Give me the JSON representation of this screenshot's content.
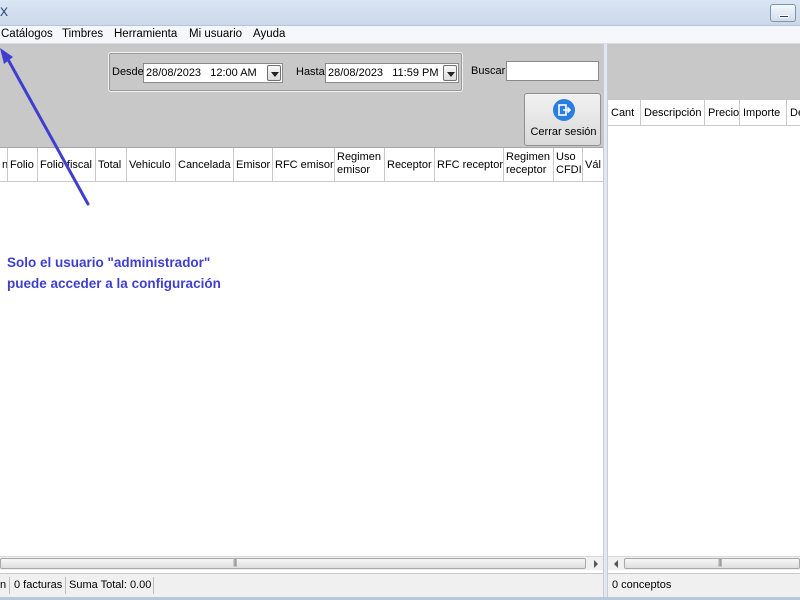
{
  "window": {
    "title_fragment": "X"
  },
  "menu": {
    "items": [
      "Catálogos",
      "Timbres",
      "Herramienta",
      "Mi usuario",
      "Ayuda"
    ]
  },
  "filters": {
    "desde_label": "Desde",
    "desde_date": "28/08/2023",
    "desde_time": "12:00  AM",
    "hasta_label": "Hasta",
    "hasta_date": "28/08/2023",
    "hasta_time": "11:59  PM",
    "buscar_label": "Buscar",
    "buscar_value": ""
  },
  "logout": {
    "label": "Cerrar sesión",
    "icon": "logout-icon",
    "icon_color": "#2a7de1"
  },
  "invoice_grid": {
    "columns": [
      "n",
      "Folio",
      "Folio fiscal",
      "Total",
      "Vehiculo",
      "Cancelada",
      "Emisor",
      "RFC emisor",
      "Regimen emisor",
      "Receptor",
      "RFC receptor",
      "Regimen receptor",
      "Uso CFDI",
      "Vál"
    ],
    "rows": []
  },
  "concepts_grid": {
    "columns": [
      "Cant",
      "Descripción",
      "Precio",
      "Importe",
      "De"
    ],
    "rows": []
  },
  "annotation": {
    "line1": "Solo el usuario \"administrador\"",
    "line2": "puede acceder a la configuración",
    "color": "#3f3fcf"
  },
  "status": {
    "left_fragment": "n",
    "facturas": "0 facturas",
    "suma_total": "Suma Total: 0.00",
    "conceptos": "0 conceptos"
  }
}
